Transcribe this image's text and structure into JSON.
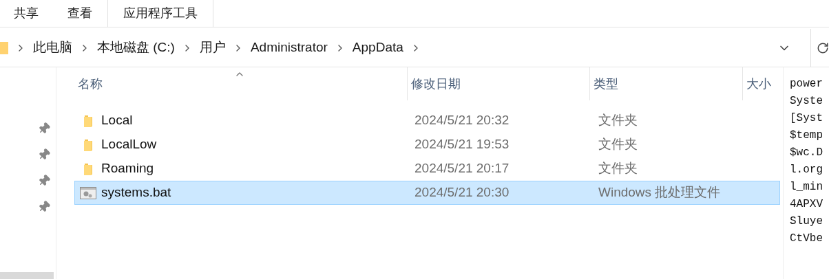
{
  "ribbon_tabs": [
    {
      "label": "共享"
    },
    {
      "label": "查看"
    },
    {
      "label": "应用程序工具"
    }
  ],
  "address_bar": {
    "crumbs": [
      "此电脑",
      "本地磁盘 (C:)",
      "用户",
      "Administrator",
      "AppData"
    ]
  },
  "quick_access": {
    "items": [
      {
        "pinned": true
      },
      {
        "pinned": true
      },
      {
        "pinned": true
      },
      {
        "pinned": true
      }
    ]
  },
  "file_list": {
    "columns": [
      "名称",
      "修改日期",
      "类型",
      "大小"
    ],
    "rows": [
      {
        "name": "Local",
        "date": "2024/5/21 20:32",
        "type": "文件夹",
        "kind": "folder",
        "selected": false
      },
      {
        "name": "LocalLow",
        "date": "2024/5/21 19:53",
        "type": "文件夹",
        "kind": "folder",
        "selected": false
      },
      {
        "name": "Roaming",
        "date": "2024/5/21 20:17",
        "type": "文件夹",
        "kind": "folder",
        "selected": false
      },
      {
        "name": "systems.bat",
        "date": "2024/5/21 20:30",
        "type": "Windows 批处理文件",
        "kind": "batch",
        "selected": true
      }
    ]
  },
  "preview_pane": {
    "lines": [
      "power",
      "Syste",
      "[Syst",
      "$temp",
      "$wc.D",
      "l.org",
      "l_min",
      "4APXV",
      "Sluye",
      "CtVbe"
    ]
  }
}
